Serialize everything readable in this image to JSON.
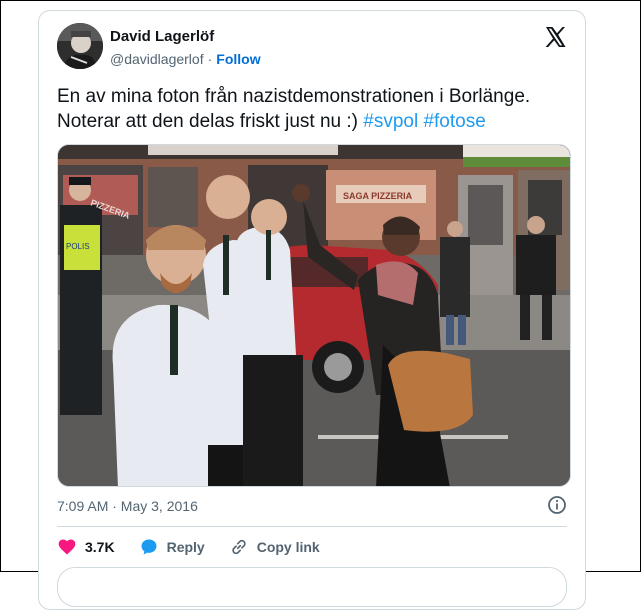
{
  "author": {
    "name": "David Lagerlöf",
    "handle": "@davidlagerlof",
    "follow_label": "Follow",
    "avatar_icon": "profile-photo"
  },
  "platform": {
    "logo_icon": "x-logo"
  },
  "tweet": {
    "text_line1": "En av mina foton från nazistdemonstrationen i Borlänge.",
    "text_line2_prefix": "Noterar att den delas friskt just nu :) ",
    "hashtag1": "#svpol",
    "hashtag2": "#fotose"
  },
  "media": {
    "sign_left": "PIZZERIA",
    "sign_right": "SAGA PIZZERIA",
    "police_label": "POLIS"
  },
  "meta": {
    "timestamp": "7:09 AM · May 3, 2016",
    "info_icon": "info-icon"
  },
  "actions": {
    "like_count": "3.7K",
    "reply_label": "Reply",
    "copy_link_label": "Copy link"
  },
  "colors": {
    "link": "#1d9bf0",
    "follow": "#006fd6",
    "like": "#f91880",
    "reply": "#1d9bf0"
  }
}
